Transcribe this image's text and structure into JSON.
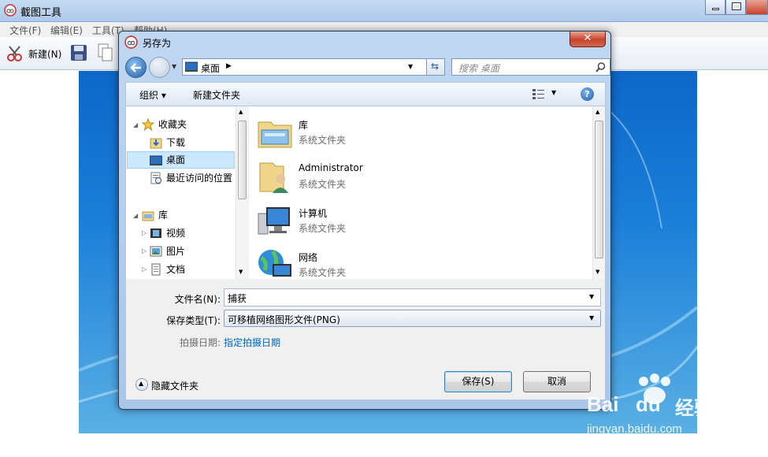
{
  "outer": {
    "title": "截图工具",
    "menu": [
      "文件(F)",
      "编辑(E)",
      "工具(T)",
      "帮助(H)"
    ],
    "new_label": "新建(N)"
  },
  "dialog": {
    "title": "另存为",
    "close_glyph": "✕",
    "address": "桌面",
    "search_placeholder": "搜索 桌面",
    "organize": "组织 ▾",
    "new_folder": "新建文件夹",
    "help": "?",
    "nav": {
      "favorites": "收藏夹",
      "downloads": "下载",
      "desktop": "桌面",
      "recent": "最近访问的位置",
      "libraries": "库",
      "videos": "视频",
      "pictures": "图片",
      "documents": "文档"
    },
    "files": [
      {
        "name": "库",
        "type": "系统文件夹",
        "icon": "library-icon"
      },
      {
        "name": "Administrator",
        "type": "系统文件夹",
        "icon": "user-folder-icon"
      },
      {
        "name": "计算机",
        "type": "系统文件夹",
        "icon": "computer-icon"
      },
      {
        "name": "网络",
        "type": "系统文件夹",
        "icon": "network-icon"
      }
    ],
    "filename_label": "文件名(N):",
    "filename_value": "捕获",
    "filetype_label": "保存类型(T):",
    "filetype_value": "可移植网络图形文件(PNG)",
    "date_label": "拍摄日期:",
    "date_link": "指定拍摄日期",
    "hide_folders": "隐藏文件夹",
    "save": "保存(S)",
    "cancel": "取消"
  },
  "watermark": {
    "brand": "Bai",
    "brand2": "du",
    "cn": "经验",
    "url": "jingyan.baidu.com"
  },
  "colors": {
    "accent": "#1f5ea8",
    "link": "#0066cc",
    "selected": "#cce8ff"
  }
}
